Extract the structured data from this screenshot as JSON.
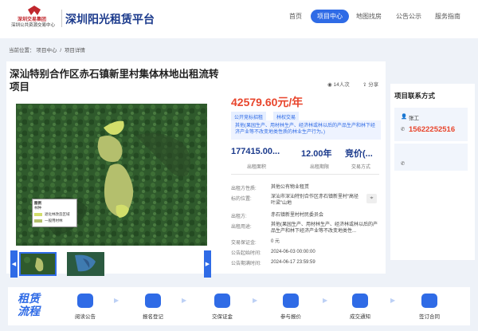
{
  "header": {
    "logo_line1": "深圳交易集团",
    "logo_line2": "深圳公共资源交易中心",
    "site_title": "深圳阳光租赁平台",
    "nav": [
      "首页",
      "项目中心",
      "地图找房",
      "公告公示",
      "服务指南"
    ],
    "active_nav": "项目中心"
  },
  "breadcrumb": [
    "当前位置：",
    "项目中心",
    " / ",
    "项目详情"
  ],
  "project": {
    "title": "深汕特别合作区赤石镇新里村集体林地出租流转项目",
    "views": "14人次",
    "share": "分享",
    "price": "42579.60元/年",
    "tags": [
      "公开竞标招租",
      "林权交易"
    ],
    "use_note": "其他(果园生产、用材林生产、经济林或林以后的产品生产和林下经济产业等不改变地类性质的林业生产行为。)",
    "stats": [
      {
        "value": "177415.00...",
        "label": "出租面积"
      },
      {
        "value": "12.00年",
        "label": "出租期限"
      },
      {
        "value": "竞价(...",
        "label": "交易方式"
      }
    ],
    "details": [
      {
        "key": "出租方性质:",
        "value": "其他公有物业租赁"
      },
      {
        "key": "标的位置:",
        "value": "深汕市深汕特别合作区赤石镇新里村“高径叶梁”山地"
      },
      {
        "key": "出租方:",
        "value": "赤石镇新里村村民委员会"
      },
      {
        "key": "出租用途:",
        "value": "其他(果园生产、用材林生产、经济林或林以后的产品生产和林下经济产业等不改变地类性..."
      },
      {
        "key": "交易保证金:",
        "value": "0 元"
      },
      {
        "key": "公告起始时间:",
        "value": "2024-06-03 00:00:00"
      },
      {
        "key": "公告期满时间:",
        "value": "2024-06-17 23:59:59"
      }
    ]
  },
  "map": {
    "legend_title": "图例",
    "legend_sub": "林种",
    "legend_items": [
      "退化林改造区域",
      "一般用材林"
    ],
    "colors": {
      "zone_main": "#b4bf6d",
      "zone_alt": "#d2de6b"
    }
  },
  "contact": {
    "title": "项目联系方式",
    "name": "张工",
    "phone": "15622252516"
  },
  "process": {
    "title_line1": "租赁",
    "title_line2": "流程",
    "steps": [
      "阅读公告",
      "报名登记",
      "交保证金",
      "参与报价",
      "成交通知",
      "签订合同"
    ]
  },
  "colors": {
    "accent": "#2f6be6",
    "price": "#e8452c",
    "brand": "#1b3a8c"
  }
}
